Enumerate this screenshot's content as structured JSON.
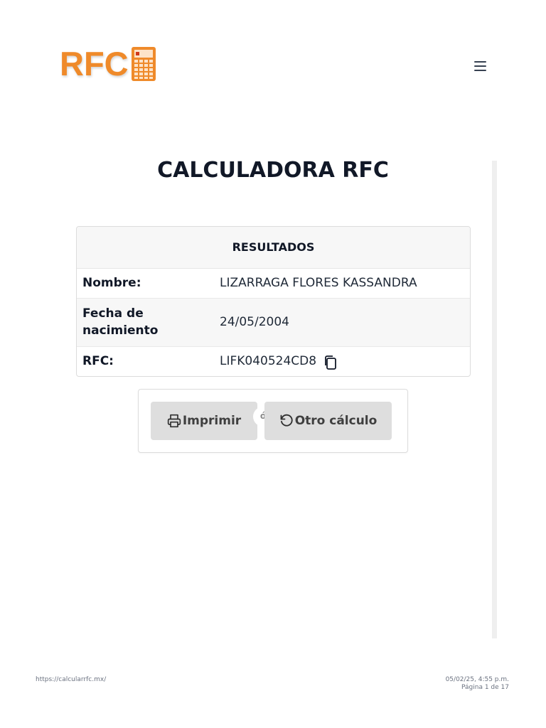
{
  "header": {
    "logo_text": "RFC",
    "logo_icon": "calculator-icon",
    "menu_icon": "hamburger-menu-icon",
    "brand_color": "#ef8a2a"
  },
  "main": {
    "title": "CALCULADORA RFC",
    "results": {
      "heading": "RESULTADOS",
      "rows": [
        {
          "label": "Nombre:",
          "value": "LIZARRAGA FLORES KASSANDRA"
        },
        {
          "label": "Fecha de nacimiento",
          "value": "24/05/2004"
        },
        {
          "label": "RFC:",
          "value": "LIFK040524CD8"
        }
      ],
      "copy_icon": "copy-icon"
    },
    "actions": {
      "print_label": "Imprimir",
      "print_icon": "printer-icon",
      "or_label": "ó",
      "reset_label": "Otro cálculo",
      "reset_icon": "rotate-ccw-icon",
      "button_color": "#dedede"
    }
  },
  "footer": {
    "url": "https://calcularrfc.mx/",
    "datetime": "05/02/25, 4:55 p.m.",
    "page": "Página 1 de 17"
  }
}
